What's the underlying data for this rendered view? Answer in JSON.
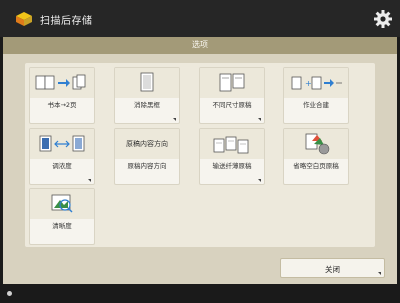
{
  "app": {
    "title": "扫描后存储",
    "icon": "folder-scan-icon"
  },
  "panel": {
    "title": "选项"
  },
  "options": [
    {
      "name": "book-to-2-pages",
      "label": "书本→2页",
      "icon": "book-to-two-pages-icon"
    },
    {
      "name": "erase-frame",
      "label": "消除黑框",
      "icon": "erase-frame-icon"
    },
    {
      "name": "different-size-originals",
      "label": "不同尺寸原稿",
      "icon": "different-size-originals-icon"
    },
    {
      "name": "job-build",
      "label": "作业合建",
      "icon": "job-build-icon"
    },
    {
      "name": "density",
      "label": "调浓度",
      "icon": "density-icon"
    },
    {
      "name": "original-content-orientation",
      "label": "原稿内容方向",
      "icon_text": "原稿内容方向",
      "icon": "orientation-text-icon"
    },
    {
      "name": "thin-originals",
      "label": "输送纤薄原稿",
      "icon": "thin-originals-icon"
    },
    {
      "name": "skip-blank-originals",
      "label": "省略空白页原稿",
      "icon": "skip-blank-originals-icon"
    },
    {
      "name": "sharpness",
      "label": "清晰度",
      "icon": "sharpness-icon"
    }
  ],
  "close_button": {
    "label": "关闭"
  },
  "colors": {
    "accent": "#a39a78",
    "panel": "#d8d2bf",
    "tile": "#f6f4ee",
    "titlebar": "#262626"
  }
}
